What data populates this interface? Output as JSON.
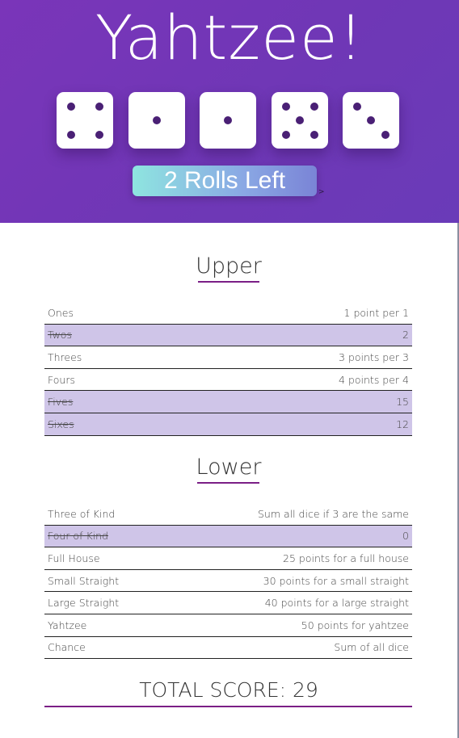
{
  "app": {
    "title": "Yahtzee!"
  },
  "dice": [
    {
      "value": 4
    },
    {
      "value": 1
    },
    {
      "value": 1
    },
    {
      "value": 5
    },
    {
      "value": 3
    }
  ],
  "roll_button": {
    "label": "2 Rolls Left",
    "arrow": ">"
  },
  "upper": {
    "title": "Upper",
    "rows": [
      {
        "name": "Ones",
        "value": "1 point per 1",
        "used": false
      },
      {
        "name": "Twos",
        "value": "2",
        "used": true
      },
      {
        "name": "Threes",
        "value": "3 points per 3",
        "used": false
      },
      {
        "name": "Fours",
        "value": "4 points per 4",
        "used": false
      },
      {
        "name": "Fives",
        "value": "15",
        "used": true
      },
      {
        "name": "Sixes",
        "value": "12",
        "used": true
      }
    ]
  },
  "lower": {
    "title": "Lower",
    "rows": [
      {
        "name": "Three of Kind",
        "value": "Sum all dice if 3 are the same",
        "used": false
      },
      {
        "name": "Four of Kind",
        "value": "0",
        "used": true
      },
      {
        "name": "Full House",
        "value": "25 points for a full house",
        "used": false
      },
      {
        "name": "Small Straight",
        "value": "30 points for a small straight",
        "used": false
      },
      {
        "name": "Large Straight",
        "value": "40 points for a large straight",
        "used": false
      },
      {
        "name": "Yahtzee",
        "value": "50 points for yahtzee",
        "used": false
      },
      {
        "name": "Chance",
        "value": "Sum of all dice",
        "used": false
      }
    ]
  },
  "total": {
    "label": "TOTAL SCORE: 29"
  },
  "colors": {
    "header": "#7436b8",
    "die_pip": "#4a2075",
    "used_row": "#cfc5e8",
    "underline": "#7b1f86"
  }
}
